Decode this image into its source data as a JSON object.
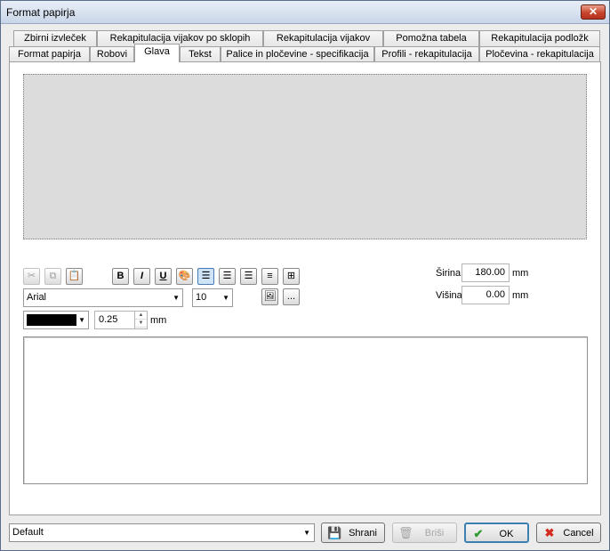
{
  "window": {
    "title": "Format papirja",
    "close_glyph": "✕"
  },
  "tabs_row1": [
    {
      "label": "Zbirni izvleček"
    },
    {
      "label": "Rekapitulacija vijakov po sklopih"
    },
    {
      "label": "Rekapitulacija vijakov"
    },
    {
      "label": "Pomožna tabela"
    },
    {
      "label": "Rekapitulacija podložk"
    }
  ],
  "tabs_row2": [
    {
      "label": "Format papirja"
    },
    {
      "label": "Robovi"
    },
    {
      "label": "Glava"
    },
    {
      "label": "Tekst"
    },
    {
      "label": "Palice in pločevine - specifikacija"
    },
    {
      "label": "Profili - rekapitulacija"
    },
    {
      "label": "Pločevina - rekapitulacija"
    }
  ],
  "active_tab": "Glava",
  "toolbar": {
    "font_name": "Arial",
    "font_size": "10",
    "line_width": "0.25",
    "line_unit": "mm",
    "more_label": "...",
    "bold": "B",
    "italic": "I",
    "underline": "U",
    "line_color": "#000000"
  },
  "size": {
    "width_label": "Širina",
    "width_value": "180.00",
    "width_unit": "mm",
    "height_label": "Višina",
    "height_value": "0.00",
    "height_unit": "mm"
  },
  "footer": {
    "preset": "Default",
    "save_label": "Shrani",
    "delete_label": "Briši",
    "ok_label": "OK",
    "cancel_label": "Cancel"
  }
}
